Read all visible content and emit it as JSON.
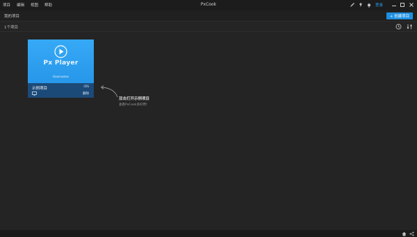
{
  "menu": [
    "项目",
    "编辑",
    "视图",
    "帮助"
  ],
  "app_title": "PxCook",
  "header": {
    "login_label": "登录"
  },
  "breadcrumb": "我的项目",
  "new_project_label": "+ 创建项目",
  "project_count": "1个项目",
  "project": {
    "name": "示例项目",
    "platform": "iOS",
    "delete_label": "删除",
    "thumb_title": "Px Player",
    "thumb_subtitle": "Username"
  },
  "hint": {
    "title": "双击打开示例项目",
    "subtitle": "查看PxCook多好用!"
  },
  "colors": {
    "accent": "#1e8fe0",
    "thumb": "#36a9f6",
    "card_info": "#1c4a78"
  },
  "icons": [
    "pen-icon",
    "pin-icon",
    "bell-icon",
    "minimize-icon",
    "maximize-icon",
    "close-icon",
    "clock-icon",
    "settings-icon",
    "home-icon",
    "share-icon",
    "play-icon",
    "monitor-icon"
  ]
}
